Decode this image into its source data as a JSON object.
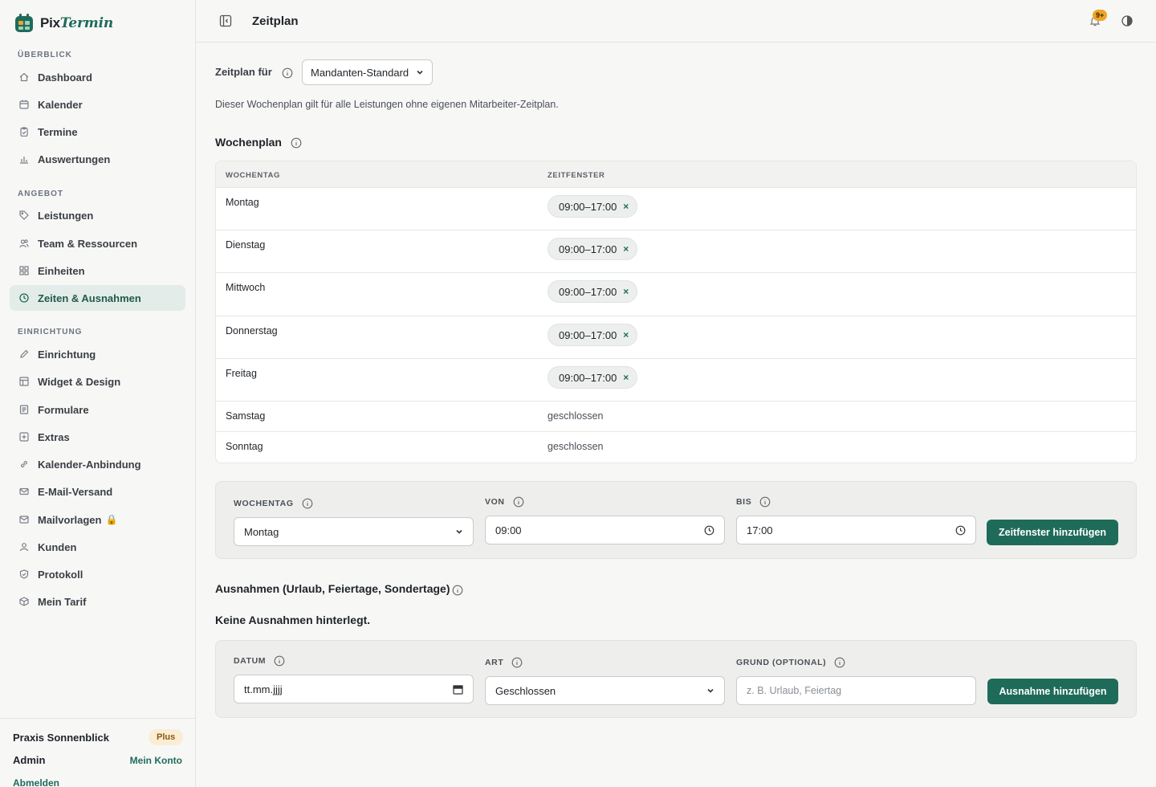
{
  "brand": {
    "name_part1": "Pix",
    "name_part2": "Termin"
  },
  "sidebar": {
    "sections": [
      {
        "title": "ÜBERBLICK"
      },
      {
        "title": "ANGEBOT"
      },
      {
        "title": "EINRICHTUNG"
      }
    ],
    "items": [
      {
        "label": "Dashboard",
        "icon": "home-icon"
      },
      {
        "label": "Kalender",
        "icon": "calendar-icon"
      },
      {
        "label": "Termine",
        "icon": "clipboard-icon"
      },
      {
        "label": "Auswertungen",
        "icon": "bar-chart-icon"
      },
      {
        "label": "Leistungen",
        "icon": "tag-icon"
      },
      {
        "label": "Team & Ressourcen",
        "icon": "users-icon"
      },
      {
        "label": "Einheiten",
        "icon": "grid-icon"
      },
      {
        "label": "Zeiten & Ausnahmen",
        "icon": "clock-icon",
        "active": true
      },
      {
        "label": "Einrichtung",
        "icon": "pencil-icon"
      },
      {
        "label": "Widget & Design",
        "icon": "layout-icon"
      },
      {
        "label": "Formulare",
        "icon": "document-icon"
      },
      {
        "label": "Extras",
        "icon": "plus-square-icon"
      },
      {
        "label": "Kalender-Anbindung",
        "icon": "link-icon"
      },
      {
        "label": "E-Mail-Versand",
        "icon": "mail-icon"
      },
      {
        "label": "Mailvorlagen",
        "icon": "mail-template-icon",
        "locked": true
      },
      {
        "label": "Kunden",
        "icon": "user-icon"
      },
      {
        "label": "Protokoll",
        "icon": "shield-icon"
      },
      {
        "label": "Mein Tarif",
        "icon": "box-icon"
      }
    ],
    "footer": {
      "org_name": "Praxis Sonnenblick",
      "plan": "Plus",
      "role": "Admin",
      "account_link": "Mein Konto",
      "logout": "Abmelden"
    }
  },
  "header": {
    "title": "Zeitplan",
    "notification_count": "9+"
  },
  "schedule": {
    "for_label": "Zeitplan für",
    "selected": "Mandanten-Standard",
    "description": "Dieser Wochenplan gilt für alle Leistungen ohne eigenen Mitarbeiter-Zeitplan."
  },
  "weekplan": {
    "title": "Wochenplan",
    "col_day": "WOCHENTAG",
    "col_window": "ZEITFENSTER",
    "rows": [
      {
        "day": "Montag",
        "window": "09:00–17:00",
        "closed": ""
      },
      {
        "day": "Dienstag",
        "window": "09:00–17:00",
        "closed": ""
      },
      {
        "day": "Mittwoch",
        "window": "09:00–17:00",
        "closed": ""
      },
      {
        "day": "Donnerstag",
        "window": "09:00–17:00",
        "closed": ""
      },
      {
        "day": "Freitag",
        "window": "09:00–17:00",
        "closed": ""
      },
      {
        "day": "Samstag",
        "window": "",
        "closed": "geschlossen"
      },
      {
        "day": "Sonntag",
        "window": "",
        "closed": "geschlossen"
      }
    ],
    "remove_symbol": "×"
  },
  "add_window": {
    "day_label": "WOCHENTAG",
    "day_value": "Montag",
    "from_label": "VON",
    "from_value": "09:00",
    "to_label": "BIS",
    "to_value": "17:00",
    "button": "Zeitfenster hinzufügen"
  },
  "exceptions": {
    "title": "Ausnahmen (Urlaub, Feiertage, Sondertage)",
    "empty": "Keine Ausnahmen hinterlegt.",
    "date_label": "DATUM",
    "date_value": "tt.mm.jjjj",
    "type_label": "ART",
    "type_value": "Geschlossen",
    "reason_label": "GRUND (OPTIONAL)",
    "reason_placeholder": "z. B. Urlaub, Feiertag",
    "button": "Ausnahme hinzufügen"
  },
  "colors": {
    "accent": "#1f6b5a",
    "active_bg": "#e3ece8",
    "badge": "#f0a425"
  }
}
